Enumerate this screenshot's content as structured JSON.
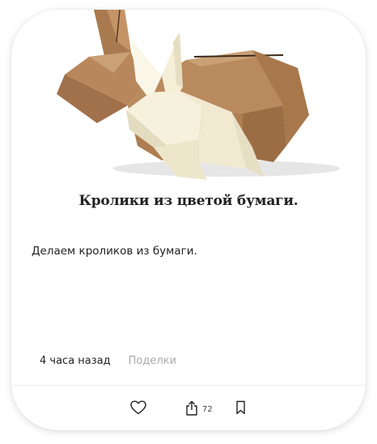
{
  "post": {
    "title": "Кролики из цветой бумаги.",
    "description": "Делаем кроликов из бумаги.",
    "time": "4 часа назад",
    "category": "Поделки"
  },
  "actions": {
    "like_icon": "heart-icon",
    "share_icon": "share-icon",
    "share_count": "72",
    "bookmark_icon": "bookmark-icon"
  },
  "image": {
    "subject": "origami paper rabbits"
  },
  "colors": {
    "text": "#222222",
    "muted": "#a8a8a8",
    "kraft": "#b8875c",
    "cream": "#f4efd8"
  }
}
